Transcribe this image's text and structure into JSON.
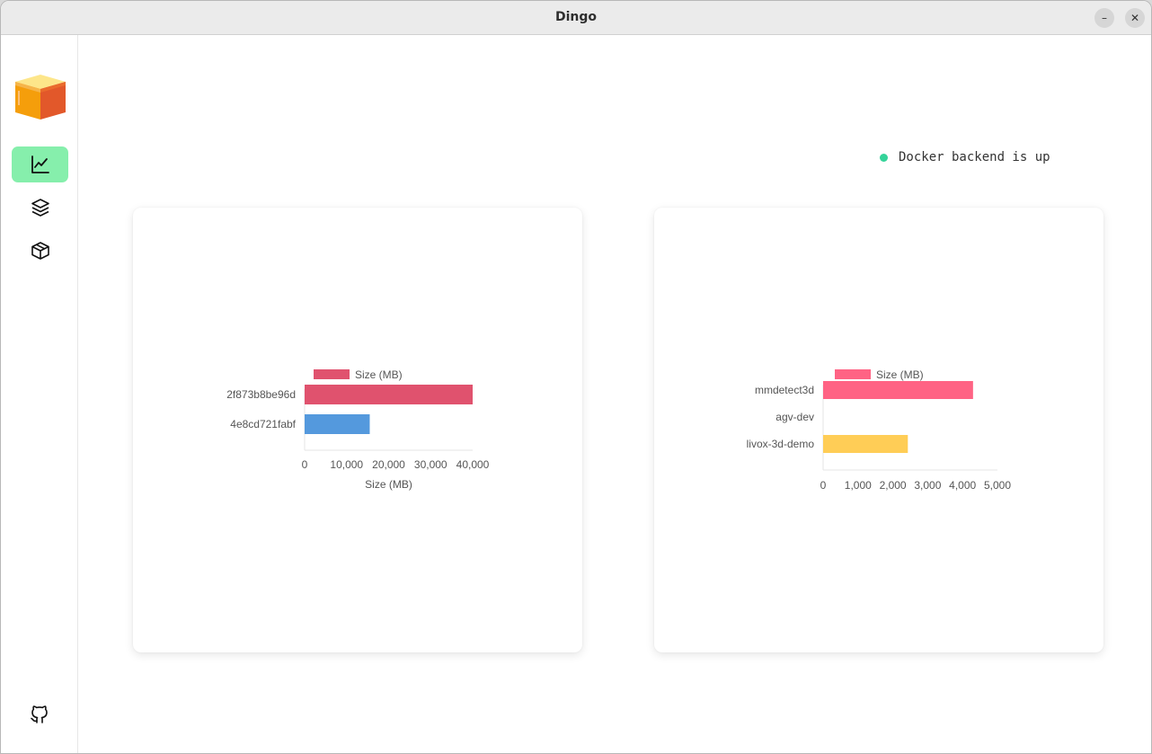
{
  "window": {
    "title": "Dingo",
    "minimize_glyph": "–",
    "close_glyph": "✕"
  },
  "sidebar": {
    "items": [
      {
        "name": "dashboard",
        "icon": "chart-line-icon",
        "active": true
      },
      {
        "name": "images",
        "icon": "layers-icon",
        "active": false
      },
      {
        "name": "containers",
        "icon": "box-icon",
        "active": false
      }
    ],
    "footer_icon": "github-icon",
    "accent": "#86efac"
  },
  "status": {
    "text": "Docker backend is up",
    "color": "#34d399"
  },
  "chart_data": [
    {
      "type": "bar",
      "orientation": "horizontal",
      "categories": [
        "2f873b8be96d",
        "4e8cd721fabf"
      ],
      "series": [
        {
          "name": "Size (MB)",
          "values": [
            40000,
            15500
          ]
        }
      ],
      "colors": [
        "#e0526e",
        "#5499dd"
      ],
      "xlabel": "Size (MB)",
      "ylabel": "",
      "xlim": [
        0,
        40000
      ],
      "xticks": [
        0,
        10000,
        20000,
        30000,
        40000
      ],
      "xtick_labels": [
        "0",
        "10,000",
        "20,000",
        "30,000",
        "40,000"
      ],
      "legend": "top",
      "grid": false
    },
    {
      "type": "bar",
      "orientation": "horizontal",
      "categories": [
        "mmdetect3d",
        "agv-dev",
        "livox-3d-demo"
      ],
      "series": [
        {
          "name": "Size (MB)",
          "values": [
            4300,
            0,
            2430
          ]
        }
      ],
      "colors": [
        "#ff6384",
        "#4bc0c0",
        "#ffcd56"
      ],
      "xlabel": "",
      "ylabel": "",
      "xlim": [
        0,
        5000
      ],
      "xticks": [
        0,
        1000,
        2000,
        3000,
        4000,
        5000
      ],
      "xtick_labels": [
        "0",
        "1,000",
        "2,000",
        "3,000",
        "4,000",
        "5,000"
      ],
      "legend": "top",
      "grid": false
    }
  ]
}
